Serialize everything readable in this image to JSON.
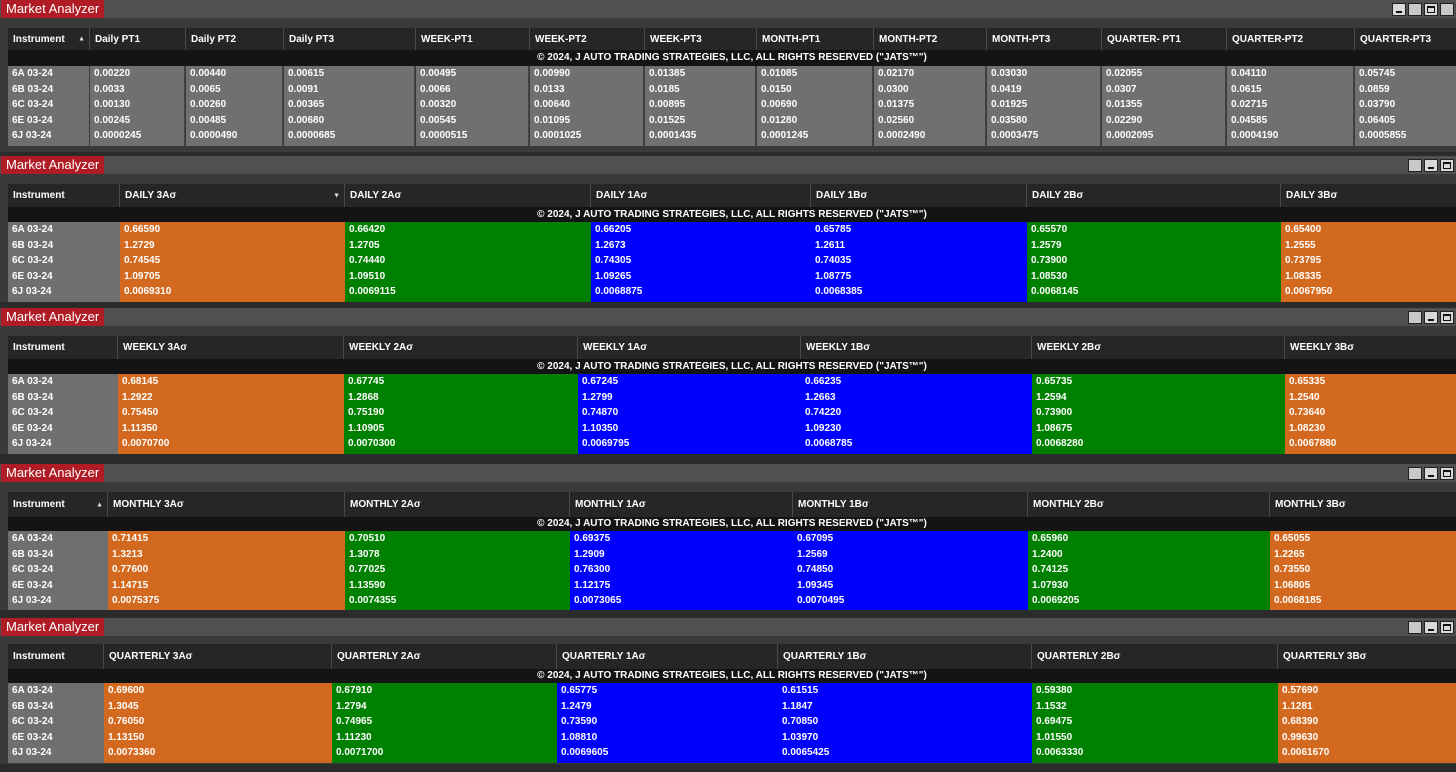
{
  "copyright": "© 2024, J AUTO TRADING STRATEGIES, LLC, ALL RIGHTS RESERVED (\"JATS™\")",
  "colors": {
    "title_red": "#b01c26",
    "orange": "#d2691e",
    "green": "#008000",
    "blue": "#0000ff",
    "gray": "#707070"
  },
  "window_title": "Market Analyzer",
  "instruments": [
    "6A 03-24",
    "6B 03-24",
    "6C 03-24",
    "6E 03-24",
    "6J 03-24"
  ],
  "windows": [
    {
      "columns": [
        {
          "label": "Instrument",
          "sort": "▲"
        },
        {
          "label": "Daily PT1"
        },
        {
          "label": "Daily PT2"
        },
        {
          "label": "Daily PT3"
        },
        {
          "label": "WEEK-PT1"
        },
        {
          "label": "WEEK-PT2"
        },
        {
          "label": "WEEK-PT3"
        },
        {
          "label": "MONTH-PT1"
        },
        {
          "label": "MONTH-PT2"
        },
        {
          "label": "MONTH-PT3"
        },
        {
          "label": "QUARTER- PT1"
        },
        {
          "label": "QUARTER-PT2"
        },
        {
          "label": "QUARTER-PT3"
        }
      ],
      "rows": [
        [
          "0.00220",
          "0.00440",
          "0.00615",
          "0.00495",
          "0.00990",
          "0.01385",
          "0.01085",
          "0.02170",
          "0.03030",
          "0.02055",
          "0.04110",
          "0.05745"
        ],
        [
          "0.0033",
          "0.0065",
          "0.0091",
          "0.0066",
          "0.0133",
          "0.0185",
          "0.0150",
          "0.0300",
          "0.0419",
          "0.0307",
          "0.0615",
          "0.0859"
        ],
        [
          "0.00130",
          "0.00260",
          "0.00365",
          "0.00320",
          "0.00640",
          "0.00895",
          "0.00690",
          "0.01375",
          "0.01925",
          "0.01355",
          "0.02715",
          "0.03790"
        ],
        [
          "0.00245",
          "0.00485",
          "0.00680",
          "0.00545",
          "0.01095",
          "0.01525",
          "0.01280",
          "0.02560",
          "0.03580",
          "0.02290",
          "0.04585",
          "0.06405"
        ],
        [
          "0.0000245",
          "0.0000490",
          "0.0000685",
          "0.0000515",
          "0.0001025",
          "0.0001435",
          "0.0001245",
          "0.0002490",
          "0.0003475",
          "0.0002095",
          "0.0004190",
          "0.0005855"
        ]
      ]
    },
    {
      "columns": [
        {
          "label": "Instrument"
        },
        {
          "label": "DAILY 3Aσ",
          "sort": "▼"
        },
        {
          "label": "DAILY 2Aσ"
        },
        {
          "label": "DAILY 1Aσ"
        },
        {
          "label": "DAILY 1Bσ"
        },
        {
          "label": "DAILY 2Bσ"
        },
        {
          "label": "DAILY 3Bσ"
        }
      ],
      "rows": [
        [
          "0.66590",
          "0.66420",
          "0.66205",
          "0.65785",
          "0.65570",
          "0.65400"
        ],
        [
          "1.2729",
          "1.2705",
          "1.2673",
          "1.2611",
          "1.2579",
          "1.2555"
        ],
        [
          "0.74545",
          "0.74440",
          "0.74305",
          "0.74035",
          "0.73900",
          "0.73795"
        ],
        [
          "1.09705",
          "1.09510",
          "1.09265",
          "1.08775",
          "1.08530",
          "1.08335"
        ],
        [
          "0.0069310",
          "0.0069115",
          "0.0068875",
          "0.0068385",
          "0.0068145",
          "0.0067950"
        ]
      ]
    },
    {
      "columns": [
        {
          "label": "Instrument"
        },
        {
          "label": "WEEKLY 3Aσ"
        },
        {
          "label": "WEEKLY 2Aσ"
        },
        {
          "label": "WEEKLY 1Aσ"
        },
        {
          "label": "WEEKLY 1Bσ"
        },
        {
          "label": "WEEKLY 2Bσ"
        },
        {
          "label": "WEEKLY 3Bσ"
        }
      ],
      "rows": [
        [
          "0.68145",
          "0.67745",
          "0.67245",
          "0.66235",
          "0.65735",
          "0.65335"
        ],
        [
          "1.2922",
          "1.2868",
          "1.2799",
          "1.2663",
          "1.2594",
          "1.2540"
        ],
        [
          "0.75450",
          "0.75190",
          "0.74870",
          "0.74220",
          "0.73900",
          "0.73640"
        ],
        [
          "1.11350",
          "1.10905",
          "1.10350",
          "1.09230",
          "1.08675",
          "1.08230"
        ],
        [
          "0.0070700",
          "0.0070300",
          "0.0069795",
          "0.0068785",
          "0.0068280",
          "0.0067880"
        ]
      ]
    },
    {
      "columns": [
        {
          "label": "Instrument",
          "sort": "▲"
        },
        {
          "label": "MONTHLY 3Aσ"
        },
        {
          "label": "MONTHLY 2Aσ"
        },
        {
          "label": "MONTHLY 1Aσ"
        },
        {
          "label": "MONTHLY 1Bσ"
        },
        {
          "label": "MONTHLY 2Bσ"
        },
        {
          "label": "MONTHLY 3Bσ"
        }
      ],
      "rows": [
        [
          "0.71415",
          "0.70510",
          "0.69375",
          "0.67095",
          "0.65960",
          "0.65055"
        ],
        [
          "1.3213",
          "1.3078",
          "1.2909",
          "1.2569",
          "1.2400",
          "1.2265"
        ],
        [
          "0.77600",
          "0.77025",
          "0.76300",
          "0.74850",
          "0.74125",
          "0.73550"
        ],
        [
          "1.14715",
          "1.13590",
          "1.12175",
          "1.09345",
          "1.07930",
          "1.06805"
        ],
        [
          "0.0075375",
          "0.0074355",
          "0.0073065",
          "0.0070495",
          "0.0069205",
          "0.0068185"
        ]
      ]
    },
    {
      "columns": [
        {
          "label": "Instrument"
        },
        {
          "label": "QUARTERLY 3Aσ"
        },
        {
          "label": "QUARTERLY 2Aσ"
        },
        {
          "label": "QUARTERLY 1Aσ"
        },
        {
          "label": "QUARTERLY 1Bσ"
        },
        {
          "label": "QUARTERLY 2Bσ"
        },
        {
          "label": "QUARTERLY 3Bσ"
        }
      ],
      "rows": [
        [
          "0.69600",
          "0.67910",
          "0.65775",
          "0.61515",
          "0.59380",
          "0.57690"
        ],
        [
          "1.3045",
          "1.2794",
          "1.2479",
          "1.1847",
          "1.1532",
          "1.1281"
        ],
        [
          "0.76050",
          "0.74965",
          "0.73590",
          "0.70850",
          "0.69475",
          "0.68390"
        ],
        [
          "1.13150",
          "1.11230",
          "1.08810",
          "1.03970",
          "1.01550",
          "0.99630"
        ],
        [
          "0.0073360",
          "0.0071700",
          "0.0069605",
          "0.0065425",
          "0.0063330",
          "0.0061670"
        ]
      ]
    }
  ]
}
